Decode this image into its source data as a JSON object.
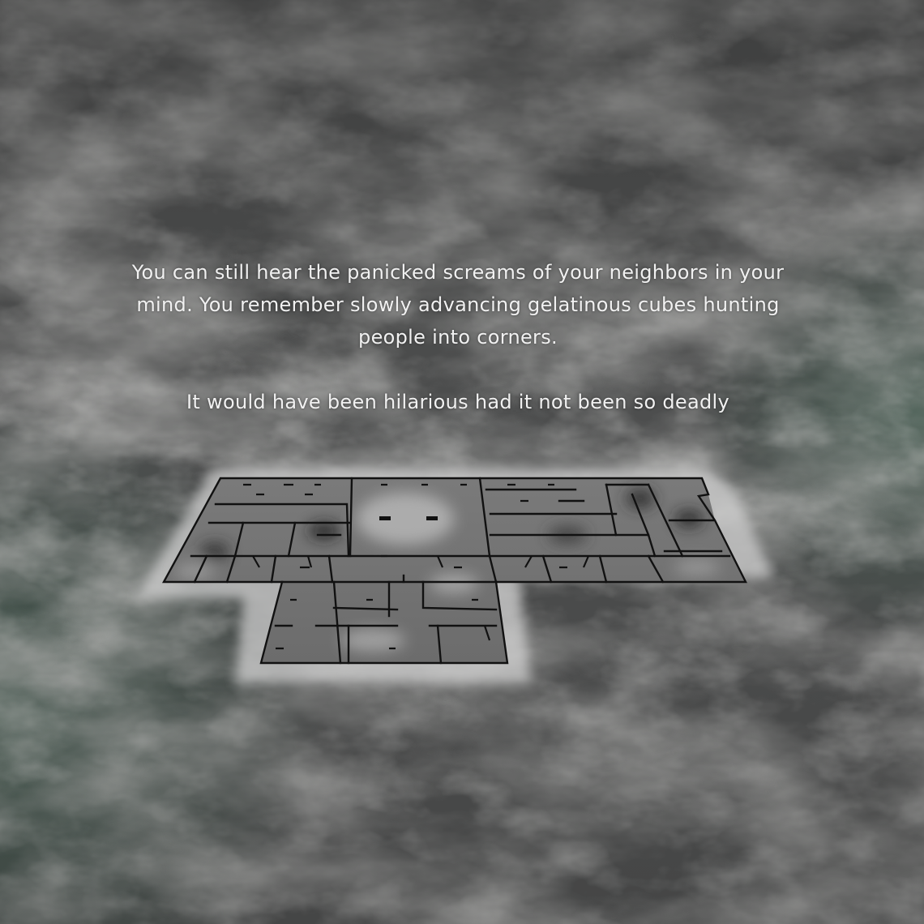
{
  "story": {
    "paragraph_1": "You can still hear the panicked screams of your neighbors in your mind. You remember slowly advancing gelatinous cubes hunting people into corners.",
    "paragraph_2": "It would have been hilarious had it not been so deadly"
  },
  "scene": {
    "background": "storm-clouds",
    "sky_tint": "#4a5a52",
    "map_style": "dungeon-floor-plan",
    "wall_color": "#111111"
  }
}
